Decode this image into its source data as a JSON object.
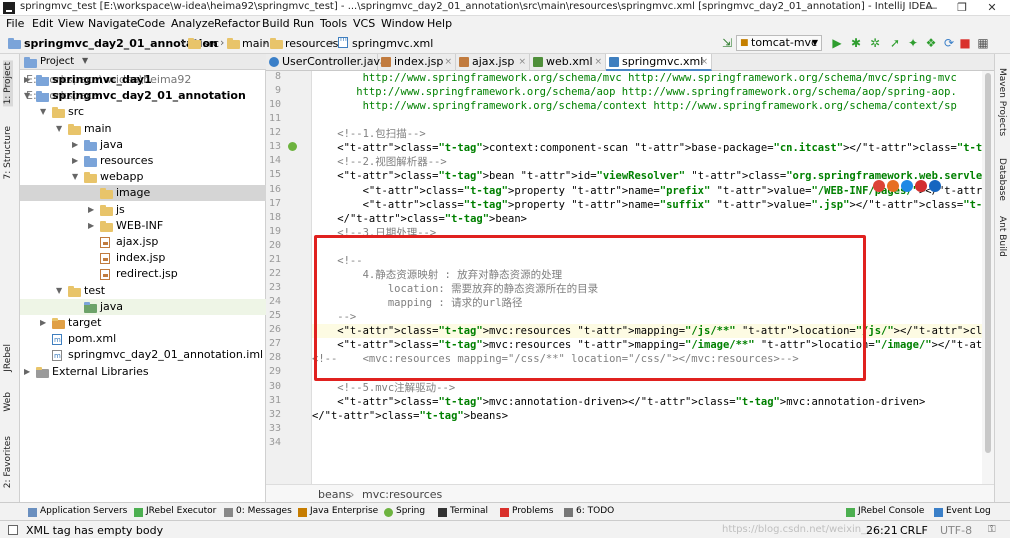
{
  "window": {
    "title": "springmvc_test [E:\\workspace\\w-idea\\heima92\\springmvc_test] - ...\\springmvc_day2_01_annotation\\src\\main\\resources\\springmvc.xml [springmvc_day2_01_annotation] - IntelliJ IDEA",
    "minimize": "—",
    "restore": "❐",
    "close": "✕"
  },
  "menu": [
    "File",
    "Edit",
    "View",
    "Navigate",
    "Code",
    "Analyze",
    "Refactor",
    "Build",
    "Run",
    "Tools",
    "VCS",
    "Window",
    "Help"
  ],
  "breadcrumbs": [
    "springmvc_day2_01_annotation",
    "src",
    "main",
    "resources",
    "springmvc.xml"
  ],
  "run_config": "tomcat-mvc",
  "left_stripe": [
    "1: Project",
    "7: Structure",
    "JRebel",
    "Web",
    "2: Favorites"
  ],
  "right_stripe": [
    "Maven Projects",
    "Database",
    "Ant Build"
  ],
  "project_panel": {
    "title": "Project",
    "rows": [
      {
        "label": "springmvc_day1",
        "path": "E:\\workspace\\w-idea\\heima92",
        "arrow": "▶",
        "indent": 0,
        "bold": true
      },
      {
        "label": "springmvc_day2_01_annotation",
        "path": "E:\\workspace",
        "arrow": "▼",
        "indent": 0,
        "bold": true
      },
      {
        "label": "src",
        "path": "",
        "arrow": "▼",
        "indent": 1
      },
      {
        "label": "main",
        "path": "",
        "arrow": "▼",
        "indent": 2
      },
      {
        "label": "java",
        "path": "",
        "arrow": "▶",
        "indent": 3
      },
      {
        "label": "resources",
        "path": "",
        "arrow": "▶",
        "indent": 3
      },
      {
        "label": "webapp",
        "path": "",
        "arrow": "▼",
        "indent": 3
      },
      {
        "label": "image",
        "path": "",
        "arrow": "",
        "indent": 4,
        "selected": true
      },
      {
        "label": "js",
        "path": "",
        "arrow": "▶",
        "indent": 4
      },
      {
        "label": "WEB-INF",
        "path": "",
        "arrow": "▶",
        "indent": 4
      },
      {
        "label": "ajax.jsp",
        "path": "",
        "arrow": "",
        "indent": 4,
        "file": "jsp"
      },
      {
        "label": "index.jsp",
        "path": "",
        "arrow": "",
        "indent": 4,
        "file": "jsp"
      },
      {
        "label": "redirect.jsp",
        "path": "",
        "arrow": "",
        "indent": 4,
        "file": "jsp"
      },
      {
        "label": "test",
        "path": "",
        "arrow": "▼",
        "indent": 2
      },
      {
        "label": "java",
        "path": "",
        "arrow": "",
        "indent": 3,
        "green": true
      },
      {
        "label": "target",
        "path": "",
        "arrow": "▶",
        "indent": 1
      },
      {
        "label": "pom.xml",
        "path": "",
        "arrow": "",
        "indent": 1,
        "file": "xml"
      },
      {
        "label": "springmvc_day2_01_annotation.iml",
        "path": "",
        "arrow": "",
        "indent": 1,
        "file": "iml"
      },
      {
        "label": "External Libraries",
        "path": "",
        "arrow": "▶",
        "indent": 0
      }
    ]
  },
  "tabs": [
    {
      "label": "UserController.java",
      "color": "#3a7fc8"
    },
    {
      "label": "index.jsp",
      "color": "#c17b3e"
    },
    {
      "label": "ajax.jsp",
      "color": "#c17b3e"
    },
    {
      "label": "web.xml",
      "color": "#4f8f3a"
    },
    {
      "label": "springmvc.xml",
      "color": "#3f7fbf",
      "active": true
    }
  ],
  "tab_close": "×",
  "line_numbers": [
    "8",
    "9",
    "10",
    "11",
    "12",
    "13",
    "14",
    "15",
    "16",
    "17",
    "18",
    "19",
    "20",
    "21",
    "22",
    "23",
    "24",
    "25",
    "26",
    "27",
    "28",
    "29",
    "30",
    "31",
    "32",
    "33",
    "34"
  ],
  "code_lines": [
    "        http://www.springframework.org/schema/mvc http://www.springframework.org/schema/mvc/spring-mvc",
    "       http://www.springframework.org/schema/aop http://www.springframework.org/schema/aop/spring-aop.",
    "        http://www.springframework.org/schema/context http://www.springframework.org/schema/context/sp",
    "",
    "    <!--1.包扫描-->",
    "    <context:component-scan base-package=\"cn.itcast\"></context:component-scan>",
    "    <!--2.视图解析器-->",
    "    <bean id=\"viewResolver\" class=\"org.springframework.web.servlet.view.InternalResourceViewResolver\">",
    "        <property name=\"prefix\" value=\"/WEB-INF/pages/\"></property>",
    "        <property name=\"suffix\" value=\".jsp\"></property>",
    "    </bean>",
    "    <!--3.日期处理-->",
    "",
    "    <!--",
    "        4.静态资源映射 : 放弃对静态资源的处理",
    "            location: 需要放弃的静态资源所在的目录",
    "            mapping : 请求的url路径",
    "    -->",
    "    <mvc:resources mapping=\"/js/**\" location=\"/js/\"></mvc:resources>",
    "    <mvc:resources mapping=\"/image/**\" location=\"/image/\"></mvc:resources>",
    "<!--    <mvc:resources mapping=\"/css/**\" location=\"/css/\"></mvc:resources>-->",
    "",
    "    <!--5.mvc注解驱动-->",
    "    <mvc:annotation-driven></mvc:annotation-driven>",
    "</beans>",
    "",
    ""
  ],
  "editor_breadcrumb": [
    "beans",
    "mvc:resources"
  ],
  "tool_windows": [
    "Application Servers",
    "JRebel Executor",
    "0: Messages",
    "Java Enterprise",
    "Spring",
    "Terminal",
    "Problems",
    "6: TODO",
    "JRebel Console",
    "Event Log"
  ],
  "status": {
    "message": "XML tag has empty body",
    "position": "26:21",
    "line_sep": "CRLF",
    "encoding": "UTF-8",
    "watermark": "https://blog.csdn.net/weixin_..."
  },
  "colors": {
    "highlight_box": "#e0211f",
    "tag": "#000080",
    "attr": "#0000ff",
    "value": "#008000",
    "comment": "#808080"
  }
}
